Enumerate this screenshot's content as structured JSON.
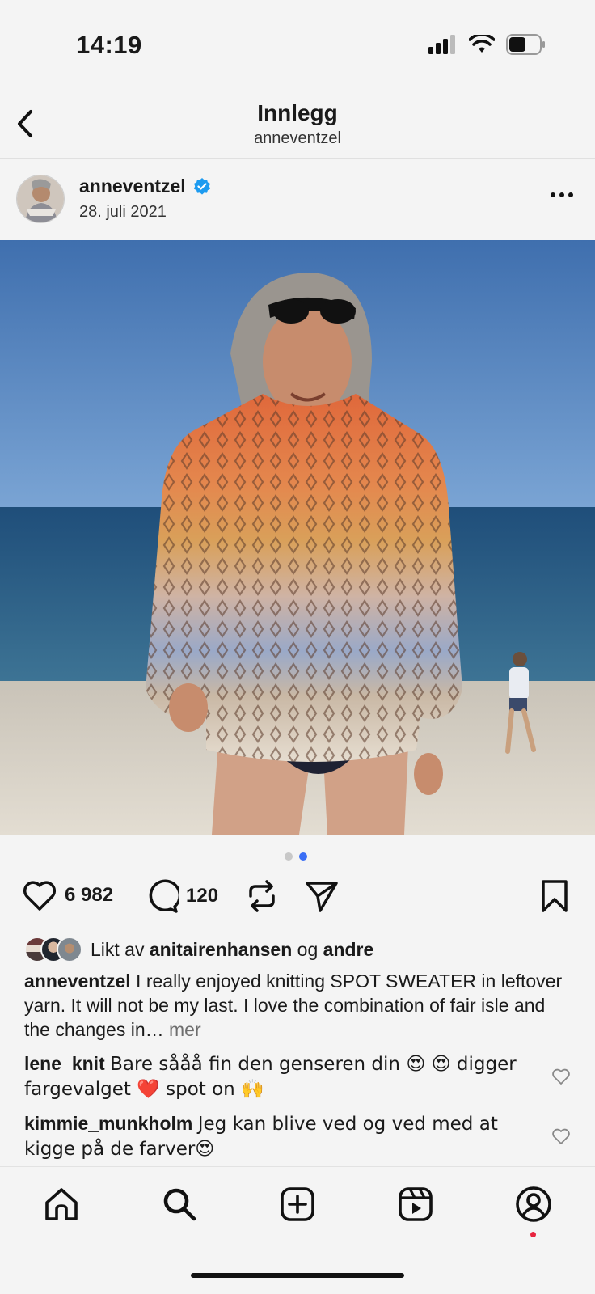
{
  "status_bar": {
    "time": "14:19"
  },
  "nav": {
    "title": "Innlegg",
    "subtitle": "anneventzel"
  },
  "post": {
    "username": "anneventzel",
    "date": "28. juli 2021",
    "image_pages": 2,
    "active_page": 2
  },
  "actions": {
    "likes": "6 982",
    "comments": "120"
  },
  "liked_by": {
    "prefix": "Likt av",
    "user": "anitairenhansen",
    "connector": "og",
    "others": "andre"
  },
  "caption": {
    "user": "anneventzel",
    "text": "I really enjoyed knitting SPOT SWEATER in leftover yarn. It will not be my last. I love the combination of fair isle and the changes in…",
    "more": "mer"
  },
  "comments": [
    {
      "user": "lene_knit",
      "text": "Bare sååå fin den genseren din 😍 😍 digger fargevalget ❤️ spot on 🙌"
    },
    {
      "user": "kimmie_munkholm",
      "text": "Jeg kan blive ved og ved med at kigge på de farver😍"
    }
  ],
  "icons": {
    "back": "chevron-left-icon",
    "more": "more-horizontal-icon",
    "verified": "verified-badge-icon",
    "like": "heart-icon",
    "comment": "comment-icon",
    "repost": "repost-icon",
    "share": "send-icon",
    "save": "bookmark-icon",
    "tabs": [
      "home-icon",
      "search-icon",
      "create-icon",
      "reels-icon",
      "profile-icon"
    ]
  },
  "colors": {
    "verified": "#1d9bf0",
    "active_dot": "#3a6ef5",
    "notification": "#e8243e"
  }
}
